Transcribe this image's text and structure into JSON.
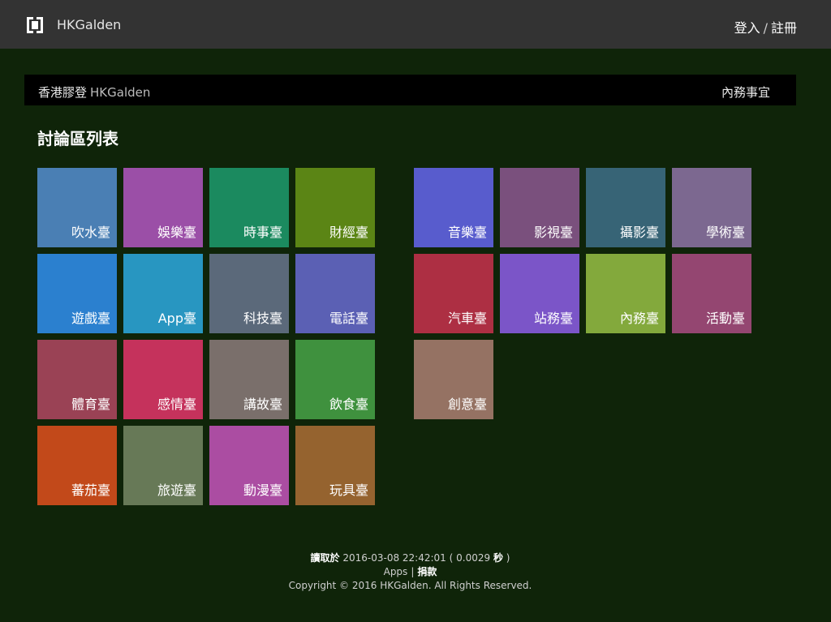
{
  "header": {
    "site_name": "HKGalden",
    "login": "登入",
    "separator": "/",
    "register": "註冊"
  },
  "breadcrumb": {
    "zh": "香港膠登",
    "en": "HKGalden",
    "internal": "內務事宜"
  },
  "section_title": "討論區列表",
  "boards_left": [
    {
      "label": "吹水臺",
      "color": "#4a7fb4"
    },
    {
      "label": "娛樂臺",
      "color": "#9b4fa7"
    },
    {
      "label": "時事臺",
      "color": "#1b8a5f"
    },
    {
      "label": "財經臺",
      "color": "#5b8515"
    },
    {
      "label": "遊戲臺",
      "color": "#2b80cf"
    },
    {
      "label": "App臺",
      "color": "#2896c1"
    },
    {
      "label": "科技臺",
      "color": "#5b697a"
    },
    {
      "label": "電話臺",
      "color": "#5b60b4"
    },
    {
      "label": "體育臺",
      "color": "#9a4255"
    },
    {
      "label": "感情臺",
      "color": "#c5325c"
    },
    {
      "label": "講故臺",
      "color": "#7a6f6b"
    },
    {
      "label": "飲食臺",
      "color": "#3f913e"
    },
    {
      "label": "蕃茄臺",
      "color": "#c2491a"
    },
    {
      "label": "旅遊臺",
      "color": "#677957"
    },
    {
      "label": "動漫臺",
      "color": "#ab4da2"
    },
    {
      "label": "玩具臺",
      "color": "#95632f"
    }
  ],
  "boards_right": [
    {
      "label": "音樂臺",
      "color": "#585ccd"
    },
    {
      "label": "影視臺",
      "color": "#7a507d"
    },
    {
      "label": "攝影臺",
      "color": "#376476"
    },
    {
      "label": "學術臺",
      "color": "#7c6890"
    },
    {
      "label": "汽車臺",
      "color": "#ad2f43"
    },
    {
      "label": "站務臺",
      "color": "#7b55c8"
    },
    {
      "label": "內務臺",
      "color": "#83a93c"
    },
    {
      "label": "活動臺",
      "color": "#944671"
    },
    {
      "label": "創意臺",
      "color": "#957263"
    }
  ],
  "footer": {
    "read_label": "讀取於",
    "timestamp": "2016-03-08 22:42:01",
    "duration_open": "( 0.0029",
    "duration_unit": "秒",
    "duration_close": ")",
    "apps": "Apps",
    "divider": "|",
    "donate": "捐款",
    "copyright": "Copyright © 2016 HKGalden. All Rights Reserved."
  }
}
